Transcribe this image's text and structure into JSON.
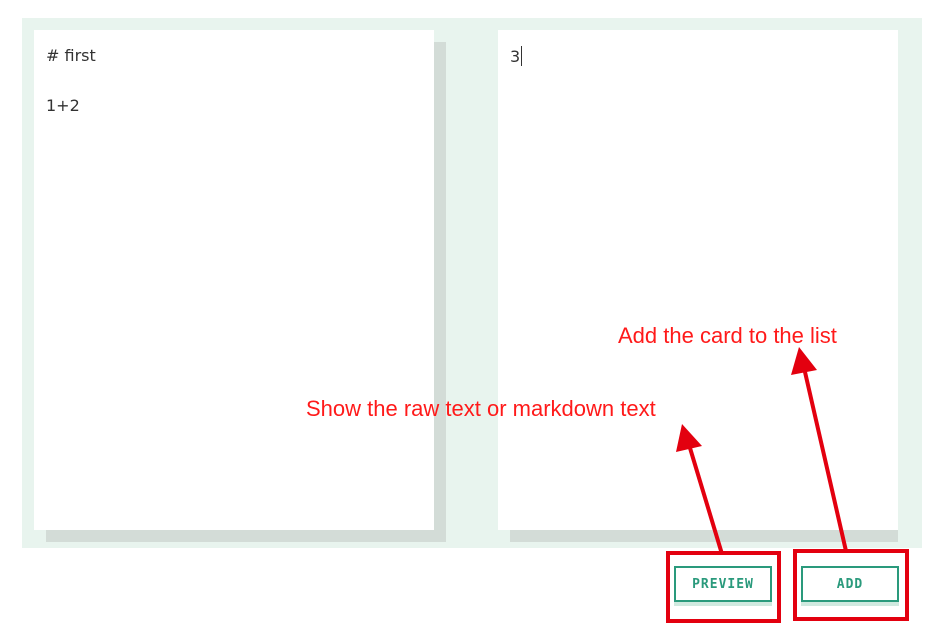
{
  "left_card": {
    "line1": "# first",
    "line2": "1+2"
  },
  "right_card": {
    "text": "3"
  },
  "buttons": {
    "preview_label": "PREVIEW",
    "add_label": "ADD"
  },
  "annotations": {
    "preview_note": "Show the raw text or markdown text",
    "add_note": "Add the card to the list"
  },
  "colors": {
    "board": "#e8f4ee",
    "accent": "#2a9a7c",
    "annotation": "#ff1a1a"
  }
}
